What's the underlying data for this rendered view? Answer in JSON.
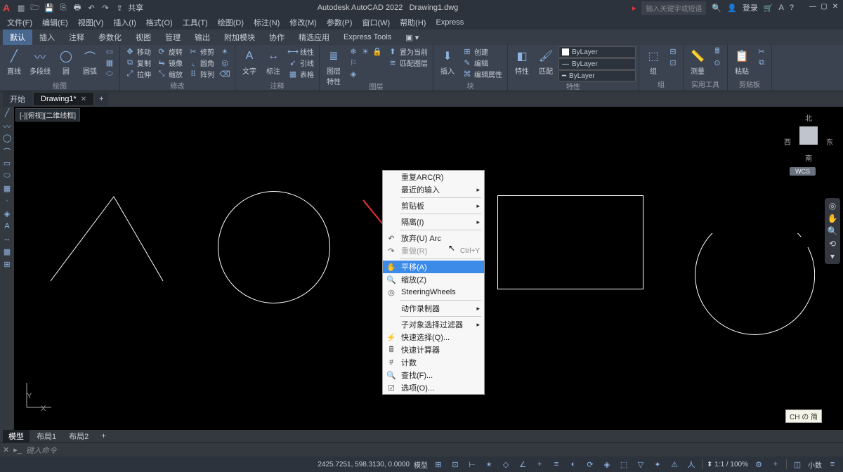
{
  "app": {
    "title": "Autodesk AutoCAD 2022",
    "file": "Drawing1.dwg",
    "share": "共享"
  },
  "search": {
    "placeholder": "输入关键字或短语",
    "login": "登录"
  },
  "menu": [
    "文件(F)",
    "编辑(E)",
    "视图(V)",
    "插入(I)",
    "格式(O)",
    "工具(T)",
    "绘图(D)",
    "标注(N)",
    "修改(M)",
    "参数(P)",
    "窗口(W)",
    "帮助(H)",
    "Express"
  ],
  "ribbon_tabs": [
    "默认",
    "插入",
    "注释",
    "参数化",
    "视图",
    "管理",
    "输出",
    "附加模块",
    "协作",
    "精选应用",
    "Express Tools"
  ],
  "panels": {
    "draw": {
      "label": "绘图",
      "line": "直线",
      "polyline": "多段线",
      "circle": "圆",
      "arc": "圆弧"
    },
    "modify": {
      "label": "修改",
      "move": "移动",
      "rotate": "旋转",
      "trim": "修剪",
      "copy": "复制",
      "mirror": "镜像",
      "fillet": "圆角",
      "stretch": "拉伸",
      "scale": "缩放",
      "array": "阵列"
    },
    "annot": {
      "label": "注释",
      "text": "文字",
      "dim": "标注",
      "linear": "线性",
      "leader": "引线",
      "table": "表格"
    },
    "layer": {
      "label": "图层",
      "prop": "图层\n特性"
    },
    "block": {
      "label": "块",
      "insert": "插入",
      "create": "创建",
      "edit": "编辑",
      "editattr": "编辑属性",
      "bringfront": "置为当前",
      "match": "匹配图层"
    },
    "props": {
      "label": "特性",
      "props": "特性",
      "match": "匹配",
      "bylayer": "ByLayer"
    },
    "group": {
      "label": "组",
      "group": "组"
    },
    "util": {
      "label": "实用工具",
      "measure": "测量"
    },
    "clip": {
      "label": "剪贴板",
      "paste": "粘贴"
    }
  },
  "doctabs": {
    "start": "开始",
    "drawing": "Drawing1*"
  },
  "viewlabel": "[-][俯视][二维线框]",
  "viewcube": {
    "n": "北",
    "s": "南",
    "e": "东",
    "w": "西",
    "wcs": "WCS"
  },
  "context": {
    "repeat": "重复ARC(R)",
    "recent": "最近的输入",
    "clip": "剪贴板",
    "isolate": "隔离(I)",
    "undo": "放弃(U) Arc",
    "redo": "重做(R)",
    "redo_sc": "Ctrl+Y",
    "pan": "平移(A)",
    "zoom": "缩放(Z)",
    "wheels": "SteeringWheels",
    "action": "动作录制器",
    "subfilter": "子对象选择过滤器",
    "qsel": "快速选择(Q)...",
    "qcalc": "快速计算器",
    "count": "计数",
    "find": "查找(F)...",
    "options": "选项(O)..."
  },
  "ime": "CH の 简",
  "layouts": {
    "model": "模型",
    "l1": "布局1",
    "l2": "布局2"
  },
  "cmd": {
    "prompt": "键入命令"
  },
  "status": {
    "coords": "2425.7251, 598.3130, 0.0000",
    "model": "模型",
    "scale": "1:1 / 100%",
    "units": "小数"
  }
}
